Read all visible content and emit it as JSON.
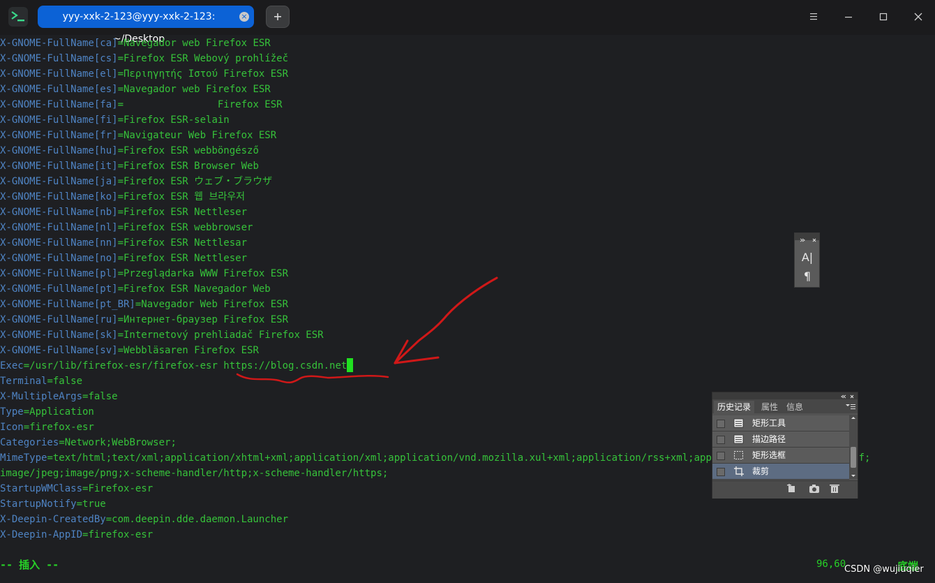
{
  "window": {
    "tab_title": "yyy-xxk-2-123@yyy-xxk-2-123: ~/Desktop",
    "tab_close": "×",
    "new_tab": "+"
  },
  "terminal": {
    "lines": [
      {
        "k": "X-GNOME-FullName[ca]",
        "v": "=Navegador web Firefox ESR"
      },
      {
        "k": "X-GNOME-FullName[cs]",
        "v": "=Firefox ESR Webový prohlížeč"
      },
      {
        "k": "X-GNOME-FullName[el]",
        "v": "=Περιηγητής Ιστού Firefox ESR"
      },
      {
        "k": "X-GNOME-FullName[es]",
        "v": "=Navegador web Firefox ESR"
      },
      {
        "k": "X-GNOME-FullName[fa]",
        "v": "=                Firefox ESR"
      },
      {
        "k": "X-GNOME-FullName[fi]",
        "v": "=Firefox ESR-selain"
      },
      {
        "k": "X-GNOME-FullName[fr]",
        "v": "=Navigateur Web Firefox ESR"
      },
      {
        "k": "X-GNOME-FullName[hu]",
        "v": "=Firefox ESR webböngésző"
      },
      {
        "k": "X-GNOME-FullName[it]",
        "v": "=Firefox ESR Browser Web"
      },
      {
        "k": "X-GNOME-FullName[ja]",
        "v": "=Firefox ESR ウェブ・ブラウザ"
      },
      {
        "k": "X-GNOME-FullName[ko]",
        "v": "=Firefox ESR 웹 브라우저"
      },
      {
        "k": "X-GNOME-FullName[nb]",
        "v": "=Firefox ESR Nettleser"
      },
      {
        "k": "X-GNOME-FullName[nl]",
        "v": "=Firefox ESR webbrowser"
      },
      {
        "k": "X-GNOME-FullName[nn]",
        "v": "=Firefox ESR Nettlesar"
      },
      {
        "k": "X-GNOME-FullName[no]",
        "v": "=Firefox ESR Nettleser"
      },
      {
        "k": "X-GNOME-FullName[pl]",
        "v": "=Przeglądarka WWW Firefox ESR"
      },
      {
        "k": "X-GNOME-FullName[pt]",
        "v": "=Firefox ESR Navegador Web"
      },
      {
        "k": "X-GNOME-FullName[pt_BR]",
        "v": "=Navegador Web Firefox ESR"
      },
      {
        "k": "X-GNOME-FullName[ru]",
        "v": "=Интернет-браузер Firefox ESR"
      },
      {
        "k": "X-GNOME-FullName[sk]",
        "v": "=Internetový prehliadač Firefox ESR"
      },
      {
        "k": "X-GNOME-FullName[sv]",
        "v": "=Webbläsaren Firefox ESR"
      },
      {
        "k": "Exec",
        "v": "=/usr/lib/firefox-esr/firefox-esr https://blog.csdn.net"
      },
      {
        "k": "Terminal",
        "v": "=false"
      },
      {
        "k": "X-MultipleArgs",
        "v": "=false"
      },
      {
        "k": "Type",
        "v": "=Application"
      },
      {
        "k": "Icon",
        "v": "=firefox-esr"
      },
      {
        "k": "Categories",
        "v": "=Network;WebBrowser;"
      },
      {
        "k": "MimeType",
        "v": "=text/html;text/xml;application/xhtml+xml;application/xml;application/vnd.mozilla.xul+xml;application/rss+xml;application/rdf+xml;image/gif;"
      },
      {
        "k": "",
        "v": "image/jpeg;image/png;x-scheme-handler/http;x-scheme-handler/https;"
      },
      {
        "k": "StartupWMClass",
        "v": "=Firefox-esr"
      },
      {
        "k": "StartupNotify",
        "v": "=true"
      },
      {
        "k": "X-Deepin-CreatedBy",
        "v": "=com.deepin.dde.daemon.Launcher"
      },
      {
        "k": "X-Deepin-AppID",
        "v": "=firefox-esr"
      }
    ],
    "status_mode": "-- 插入 --",
    "status_position": "96,60",
    "status_scroll": "底端"
  },
  "watermark": "CSDN @wujiuqier",
  "history_panel": {
    "tabs": [
      "历史记录",
      "属性",
      "信息"
    ],
    "items": [
      {
        "label": "矩形工具",
        "icon": "document-icon"
      },
      {
        "label": "描边路径",
        "icon": "document-icon"
      },
      {
        "label": "矩形选框",
        "icon": "marquee-icon"
      },
      {
        "label": "裁剪",
        "icon": "crop-icon"
      }
    ],
    "selected_index": 3
  },
  "tool_panel": {
    "char_icon": "A|",
    "para_icon": "¶"
  },
  "colors": {
    "tab_active": "#0c62d6",
    "key": "#4f84c4",
    "value": "#36c23a",
    "annotation": "#d01818"
  }
}
